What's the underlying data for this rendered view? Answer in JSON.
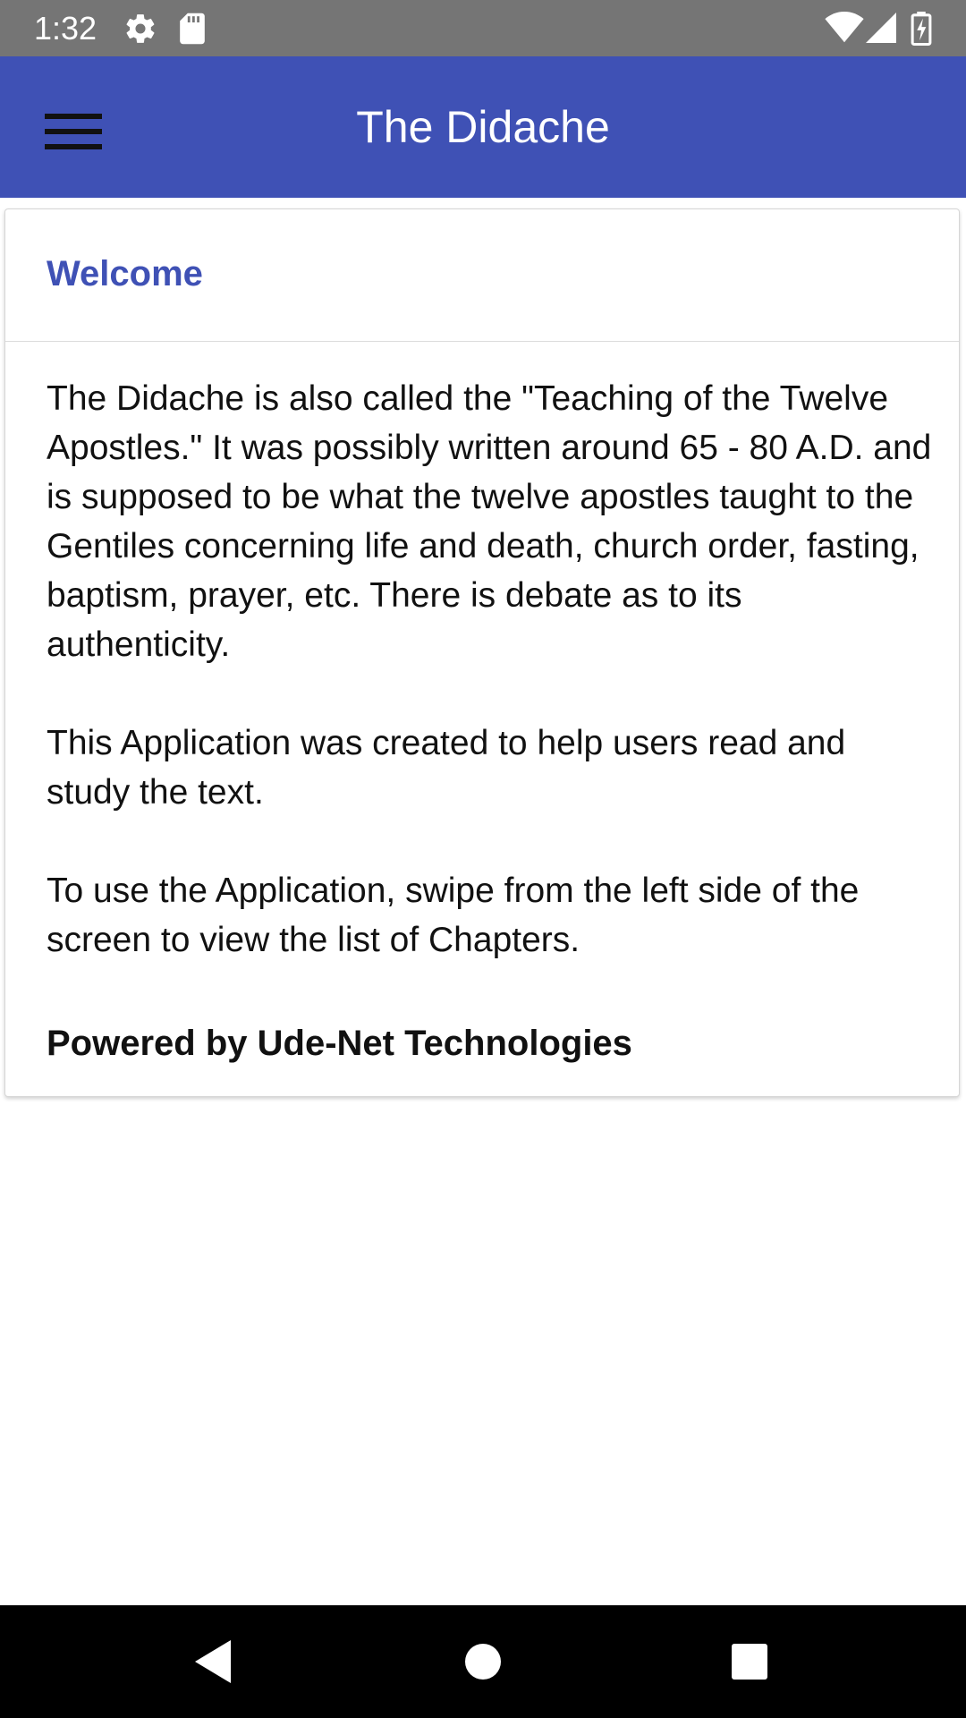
{
  "status_bar": {
    "time": "1:32",
    "icons": [
      "settings-gear-icon",
      "sd-card-icon",
      "wifi-icon",
      "cell-signal-icon",
      "battery-icon"
    ]
  },
  "app_bar": {
    "title": "The Didache",
    "menu_icon": "hamburger-menu-icon",
    "background_color": "#3f51b5"
  },
  "card": {
    "title": "Welcome",
    "title_color": "#3f51b5",
    "paragraphs": [
      "The Didache is also called the \"Teaching of the Twelve Apostles.\" It was possibly written around 65 - 80 A.D. and is supposed to be what the twelve apostles taught to the Gentiles concerning life and death, church order, fasting, baptism, prayer, etc. There is debate as to its authenticity.",
      "This Application was created to help users read and study the text.",
      "To use the Application, swipe from the left side of the screen to view the list of Chapters."
    ],
    "footer": "Powered by Ude-Net Technologies"
  },
  "nav_bar": {
    "back_icon": "back-triangle-icon",
    "home_icon": "home-circle-icon",
    "recents_icon": "recents-square-icon"
  }
}
